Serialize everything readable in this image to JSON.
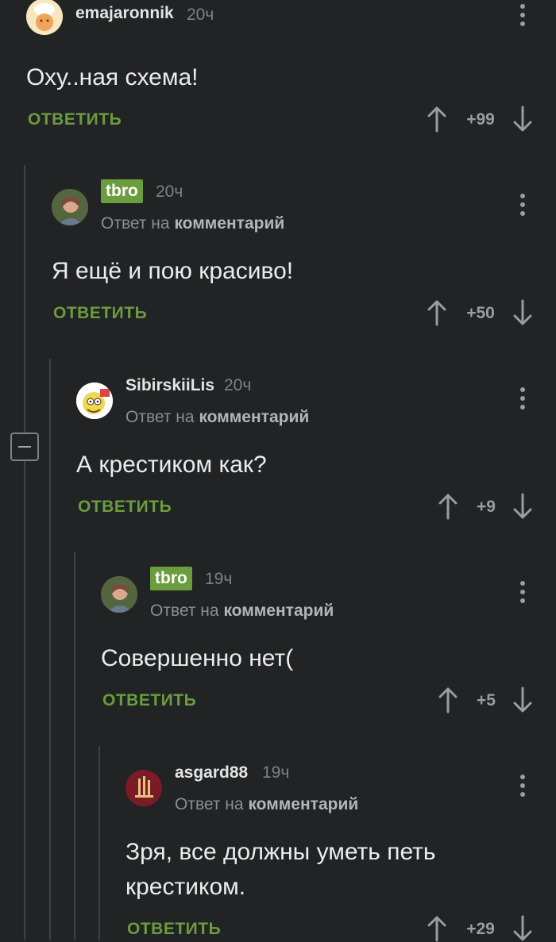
{
  "labels": {
    "reply_to_prefix": "Ответ на",
    "reply_to_target": "комментарий",
    "reply_action": "ОТВЕТИТЬ"
  },
  "comments": [
    {
      "username": "emajaronnik",
      "time": "20ч",
      "text": "Оху..ная схема!",
      "score": "+99",
      "is_op": false,
      "avatar": "chef-avatar"
    },
    {
      "username": "tbro",
      "time": "20ч",
      "text": "Я ещё и пою красиво!",
      "score": "+50",
      "is_op": true,
      "avatar": "photo-avatar"
    },
    {
      "username": "SibirskiiLis",
      "time": "20ч",
      "text": "А крестиком как?",
      "score": "+9",
      "is_op": false,
      "avatar": "cartoon-avatar"
    },
    {
      "username": "tbro",
      "time": "19ч",
      "text": "Совершенно нет(",
      "score": "+5",
      "is_op": true,
      "avatar": "photo-avatar"
    },
    {
      "username": "asgard88",
      "time": "19ч",
      "text": "Зря, все должны уметь петь крестиком.",
      "score": "+29",
      "is_op": false,
      "avatar": "logo-avatar"
    }
  ],
  "colors": {
    "background": "#212325",
    "accent_green": "#6b9c3e",
    "text": "#ececec",
    "muted": "#7e8185"
  }
}
